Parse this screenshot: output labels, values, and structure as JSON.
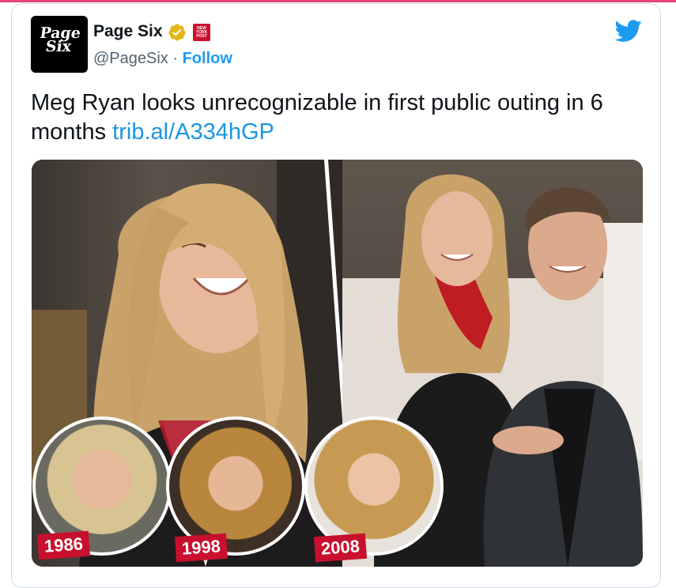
{
  "tweet": {
    "avatar_text_line1": "Page",
    "avatar_text_line2": "Six",
    "display_name": "Page Six",
    "nyp_badge_text": "NEW YORK POST",
    "handle": "@PageSix",
    "separator": " · ",
    "follow_label": "Follow",
    "text": "Meg Ryan looks unrecognizable in first public outing in 6 months ",
    "link_text": "trib.al/A334hGP"
  },
  "media": {
    "years": [
      "1986",
      "1998",
      "2008"
    ]
  },
  "colors": {
    "twitter_blue": "#1d9bf0",
    "verified_gold": "#e2b719",
    "nyp_red": "#c8102e"
  },
  "icons": {
    "verified": "verified-badge-icon",
    "twitter": "twitter-bird-icon"
  }
}
